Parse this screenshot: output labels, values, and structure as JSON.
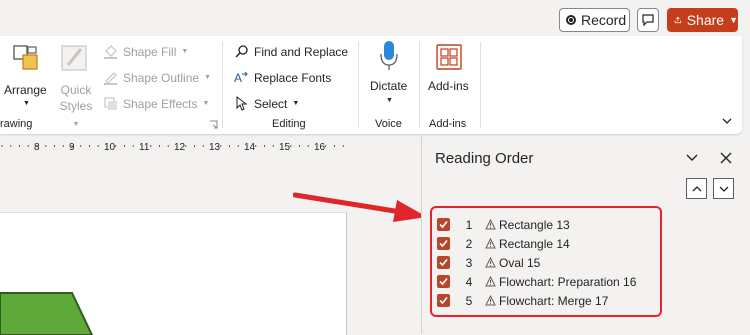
{
  "topbar": {
    "record_label": "Record",
    "share_label": "Share"
  },
  "ribbon": {
    "drawing": {
      "arrange_label": "Arrange",
      "quick_styles_label_1": "Quick",
      "quick_styles_label_2": "Styles",
      "shape_fill_label": "Shape Fill",
      "shape_outline_label": "Shape Outline",
      "shape_effects_label": "Shape Effects",
      "group_label": "rawing"
    },
    "editing": {
      "find_replace_label": "Find and Replace",
      "replace_fonts_label": "Replace Fonts",
      "select_label": "Select",
      "group_label": "Editing"
    },
    "voice": {
      "dictate_label": "Dictate",
      "group_label": "Voice"
    },
    "addins": {
      "addins_label": "Add-ins",
      "group_label": "Add-ins"
    }
  },
  "ruler": {
    "numbers": [
      "8",
      "9",
      "10",
      "11",
      "12",
      "13",
      "14",
      "15",
      "16"
    ]
  },
  "reading_order": {
    "title": "Reading Order",
    "items": [
      {
        "index": "1",
        "label": "Rectangle 13"
      },
      {
        "index": "2",
        "label": "Rectangle 14"
      },
      {
        "index": "3",
        "label": "Oval 15"
      },
      {
        "index": "4",
        "label": "Flowchart: Preparation 16"
      },
      {
        "index": "5",
        "label": "Flowchart: Merge 17"
      }
    ]
  },
  "colors": {
    "share": "#c43e1c",
    "checkbox": "#b7472a",
    "annotation_red": "#e0262b",
    "shape_green": "#5fa83a"
  }
}
